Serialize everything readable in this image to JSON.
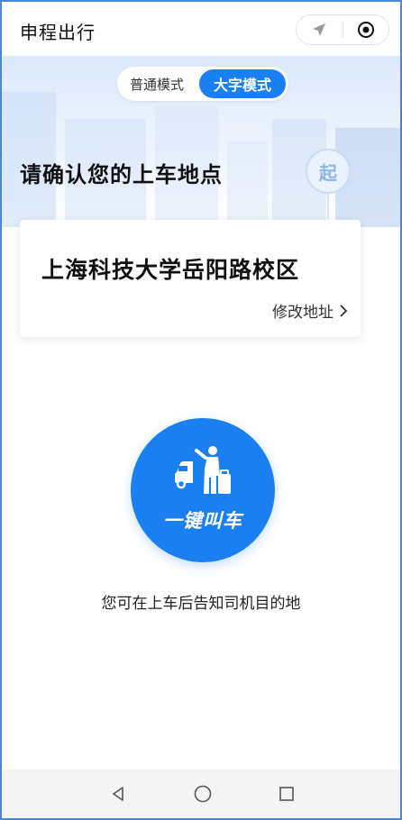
{
  "app": {
    "title": "申程出行"
  },
  "capsule": {
    "left_icon": "location-arrow-icon",
    "right_icon": "target-icon"
  },
  "mode_toggle": {
    "normal_label": "普通模式",
    "large_label": "大字模式",
    "selected": "大字模式"
  },
  "page": {
    "title": "请确认您的上车地点"
  },
  "marker": {
    "label": "起"
  },
  "address_card": {
    "address": "上海科技大学岳阳路校区",
    "modify_label": "修改地址"
  },
  "call_button": {
    "label": "一键叫车",
    "icon": "hail-taxi-icon"
  },
  "hint": {
    "text": "您可在上车后告知司机目的地"
  },
  "navbar": {
    "back_icon": "back-triangle-icon",
    "home_icon": "home-circle-icon",
    "recent_icon": "recent-square-icon"
  },
  "colors": {
    "accent": "#1a7ff0",
    "border": "#4a86d9",
    "background": "#ffffff"
  }
}
